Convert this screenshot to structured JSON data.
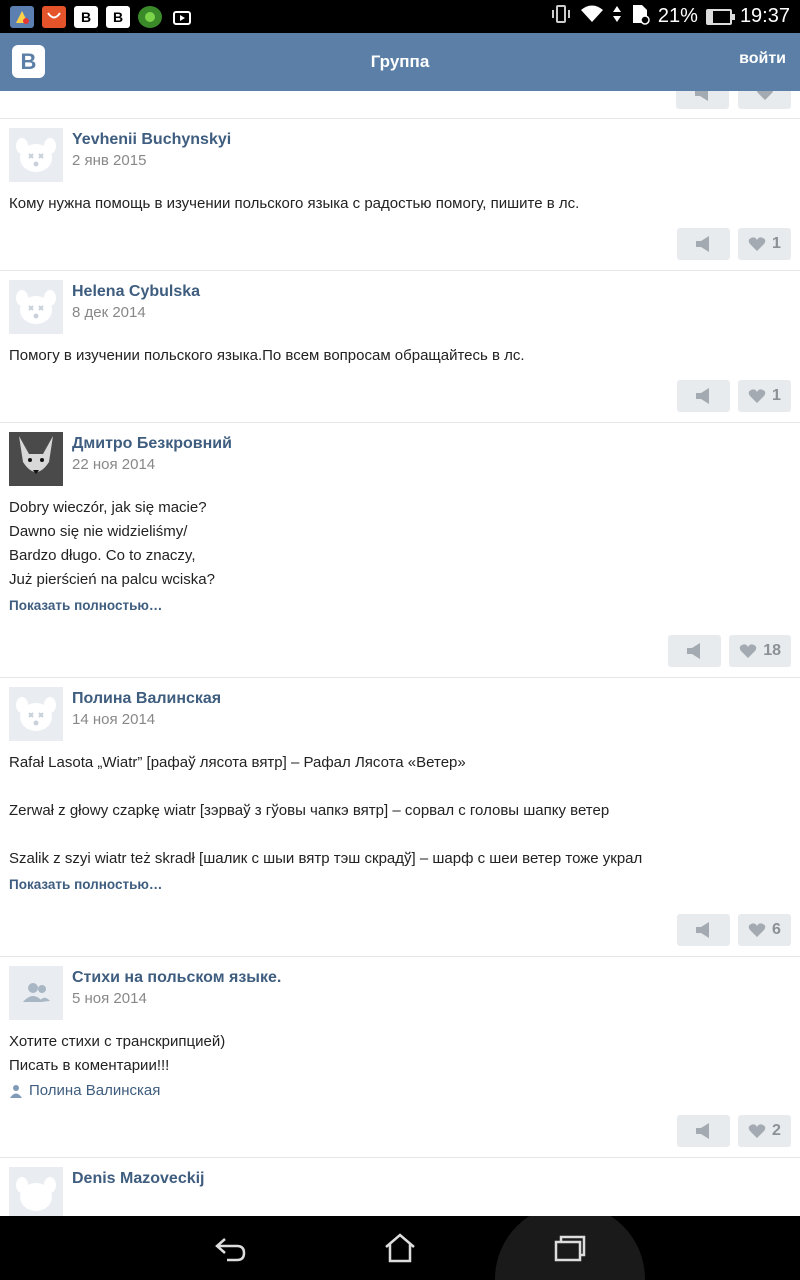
{
  "status_bar": {
    "battery": "21%",
    "battery_level": 0.21,
    "time": "19:37",
    "icons": [
      "cleaner-icon",
      "aliexpress-icon",
      "vk-b-icon",
      "vk-b-icon",
      "game-icon",
      "media-icon",
      "vibrate-icon",
      "wifi-icon",
      "sd-card-icon",
      "battery-icon"
    ]
  },
  "header": {
    "logo": "B",
    "title": "Группа",
    "login": "войти"
  },
  "posts": [
    {
      "author": "Yevhenii Buchynskyi",
      "date": "2 янв 2015",
      "text": "Кому нужна помощь в изучении польского языка с радостью помогу, пишите в лс.",
      "likes": "1",
      "avatar": "dog-avatar-icon"
    },
    {
      "author": "Helena Cybulska",
      "date": "8 дек 2014",
      "text": "Помогу в изучении польского языка.По всем вопросам обращайтесь в лс.",
      "likes": "1",
      "avatar": "dog-avatar-icon"
    },
    {
      "author": "Дмитро Безкровний",
      "date": "22 ноя 2014",
      "text": "Dobry wieczór, jak się macie?\nDawno się nie widzieliśmy/\nBardzo długo. Co to znaczy,\nJuż pierścień na palcu wciska?",
      "show_more": "Показать полностью…",
      "likes": "18",
      "avatar": "fox-photo"
    },
    {
      "author": "Полина Валинская",
      "date": "14 ноя 2014",
      "text": "Rafał Lasota „Wiatr” [рафаў лясота вятр] – Рафал Лясота «Ветер»\n\nZerwał z głowy czapkę wiatr [зэрваў з гўовы чапкэ вятр] – сорвал с головы шапку ветер\n\nSzalik z szyi wiatr też skradł [шалик с шыи вятр тэш скрадў] – шарф с шеи ветер тоже украл",
      "show_more": "Показать полностью…",
      "likes": "6",
      "avatar": "dog-avatar-icon"
    },
    {
      "author": "Стихи на польском языке.",
      "date": "5 ноя 2014",
      "text": "Хотите стихи с транскрипцией)\nПисать в коментарии!!!",
      "signer": "Полина Валинская",
      "likes": "2",
      "avatar": "group-avatar-icon"
    },
    {
      "author": "Denis Mazoveckij",
      "avatar": "dog-avatar-icon"
    }
  ],
  "colors": {
    "header_bg": "#5b7fa6",
    "link": "#3e5d7f",
    "button_bg": "#e8ebee"
  }
}
